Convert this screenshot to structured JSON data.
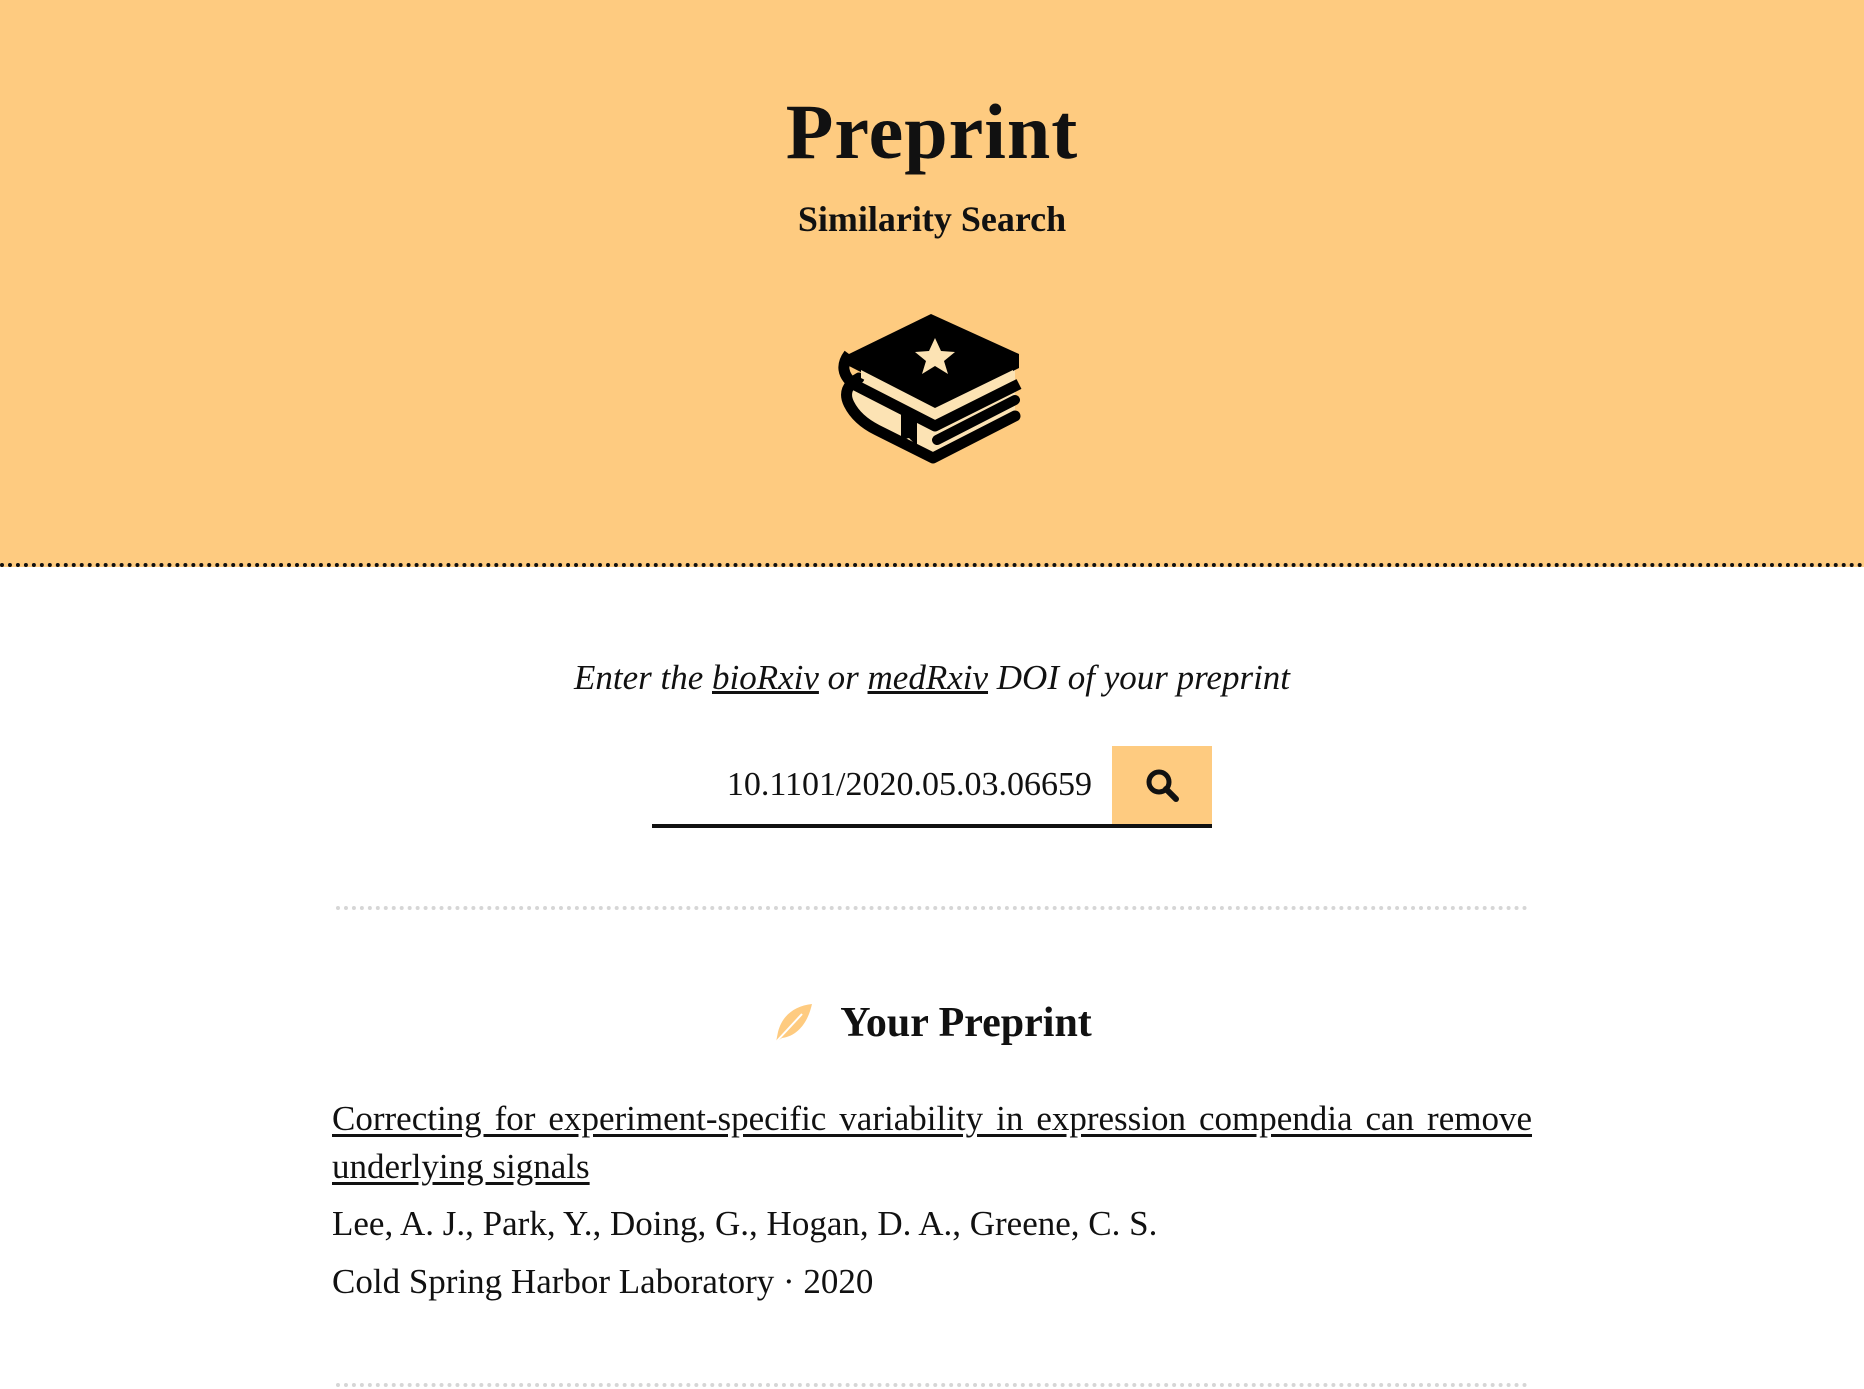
{
  "header": {
    "title": "Preprint",
    "subtitle": "Similarity Search",
    "logo_icon": "book-stack-star-icon"
  },
  "search": {
    "prompt_before": "Enter the ",
    "biorxiv_link": "bioRxiv",
    "prompt_or": " or ",
    "medrxiv_link": "medRxiv",
    "prompt_after": " DOI of your preprint",
    "value": "10.1101/2020.05.03.06659",
    "button_icon": "search-icon"
  },
  "your_preprint": {
    "heading": "Your Preprint",
    "heading_icon": "feather-icon",
    "title": "Correcting for experiment-specific variability in expression compendia can remove underlying signals",
    "authors": "Lee, A. J., Park, Y., Doing, G., Hogan, D. A., Greene, C. S.",
    "source": "Cold Spring Harbor Laboratory · 2020"
  },
  "colors": {
    "accent": "#fecb80",
    "text": "#111111",
    "divider": "#d6d6d6"
  }
}
